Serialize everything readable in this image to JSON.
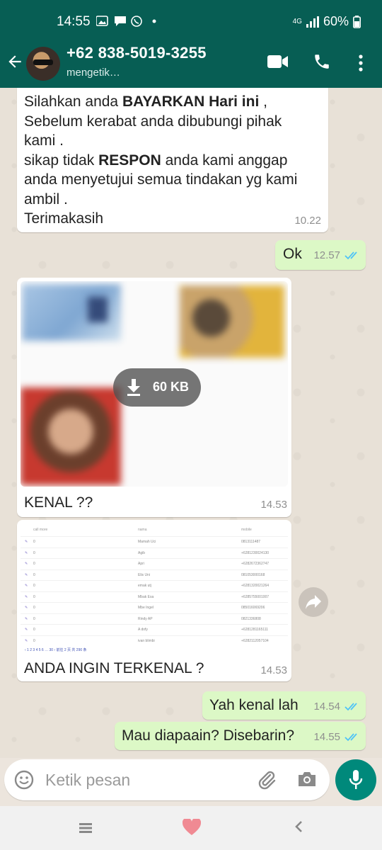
{
  "status_bar": {
    "time": "14:55",
    "network": "4G",
    "battery": "60%"
  },
  "header": {
    "contact": "+62 838-5019-3255",
    "status": "mengetik…"
  },
  "icons": {
    "back": "arrow-back-icon",
    "video": "video-call-icon",
    "call": "phone-icon",
    "menu": "more-vert-icon",
    "emoji": "emoji-icon",
    "attach": "paperclip-icon",
    "camera": "camera-icon",
    "mic": "microphone-icon",
    "forward": "forward-icon",
    "download": "download-icon"
  },
  "messages": [
    {
      "direction": "incoming",
      "lines": [
        {
          "parts": [
            {
              "text": "Silahkan anda "
            },
            {
              "text": "BAYARKAN Hari ini",
              "bold": true
            },
            {
              "text": " ,"
            }
          ]
        },
        {
          "parts": [
            {
              "text": "Sebelum kerabat anda dibubungi pihak"
            }
          ]
        },
        {
          "parts": [
            {
              "text": "kami ."
            }
          ]
        },
        {
          "parts": [
            {
              "text": "sikap tidak "
            },
            {
              "text": "RESPON",
              "bold": true
            },
            {
              "text": " anda kami anggap"
            }
          ]
        },
        {
          "parts": [
            {
              "text": "anda menyetujui semua tindakan yg kami"
            }
          ]
        },
        {
          "parts": [
            {
              "text": "ambil ."
            }
          ]
        },
        {
          "parts": [
            {
              "text": "Terimakasih"
            }
          ]
        }
      ],
      "time": "10.22"
    },
    {
      "direction": "outgoing",
      "text": "Ok",
      "time": "12.57",
      "read": true
    },
    {
      "direction": "incoming",
      "type": "image",
      "download_size": "60 KB",
      "caption": "KENAL ??",
      "time": "14.53"
    },
    {
      "direction": "incoming",
      "type": "image-table",
      "caption": "ANDA INGIN TERKENAL ?",
      "time": "14.53",
      "table": {
        "headers": [
          "call more",
          "nama",
          "mobile"
        ],
        "rows": [
          [
            "0",
            "Mamah Uci",
            "0813111487"
          ],
          [
            "0",
            "Agib",
            "+6281230024130"
          ],
          [
            "0",
            "Apri",
            "+6282672362747"
          ],
          [
            "0",
            "Elis Uni",
            "081053000168"
          ],
          [
            "0",
            "emak utj",
            "+6281320021264"
          ],
          [
            "0",
            "Mbak Esa",
            "+6285755001007"
          ],
          [
            "0",
            "Mbe Ingel",
            "085016069206"
          ],
          [
            "0",
            "Rindy AP",
            "0821336808"
          ],
          [
            "0",
            "A dofy",
            "+6281281165111"
          ],
          [
            "0",
            "ivan blimbi",
            "+6282112057104"
          ]
        ],
        "pager": "‹  1  2  3  4  5  6  …  30  ›   前往  2  页  共 290 条"
      }
    },
    {
      "direction": "outgoing",
      "text": "Yah kenal lah",
      "time": "14.54",
      "read": true
    },
    {
      "direction": "outgoing",
      "text": "Mau diapaain? Disebarin?",
      "time": "14.55",
      "read": true
    }
  ],
  "composer": {
    "placeholder": "Ketik pesan"
  },
  "colors": {
    "header": "#075e54",
    "outgoing_bubble": "#dcf8c6",
    "incoming_bubble": "#ffffff",
    "read_ticks": "#4fc3f7",
    "mic_button": "#00897b"
  }
}
